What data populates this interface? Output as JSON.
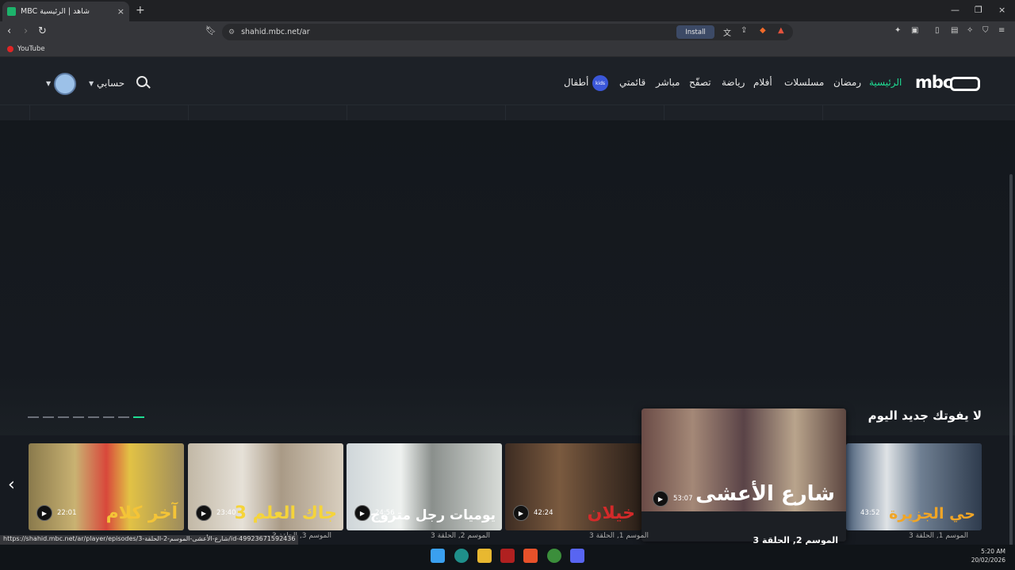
{
  "browser": {
    "tab_title": "MBC شاهد | الرئيسية",
    "tab_close": "×",
    "new_tab": "+",
    "url": "shahid.mbc.net/ar",
    "install_label": "Install",
    "bookmark_youtube": "YouTube",
    "window_minimize": "—",
    "window_restore": "❐",
    "window_close": "×"
  },
  "site": {
    "logo": "mbc",
    "nav": [
      "الرئيسية",
      "رمضان",
      "مسلسلات",
      "أفلام",
      "رياضة",
      "تصفّح",
      "مباشر",
      "قائمتي",
      "أطفال"
    ],
    "kids_badge": "kids",
    "account": "حسابي"
  },
  "content": {
    "section_title": "لا يفوتك جديد اليوم",
    "cards": [
      {
        "logo": "آخر كلام",
        "duration": "22:01",
        "caption": ""
      },
      {
        "logo": "جاك العلم 3",
        "duration": "23:40",
        "caption": "الموسم 3, الحلقة 3"
      },
      {
        "logo": "يوميات رجل متزوج",
        "duration": "24:56",
        "caption": "الموسم 2, الحلقة 3"
      },
      {
        "logo": "خيلان",
        "duration": "42:24",
        "caption": "الموسم 1, الحلقة 3"
      },
      {
        "logo": "حي الجزيرة",
        "duration": "43:52",
        "caption": "الموسم 1, الحلقة 3"
      }
    ],
    "featured": {
      "logo": "شارع الأعشى",
      "duration": "53:07",
      "caption": "الموسم 2, الحلقة 3"
    }
  },
  "status_url": "https://shahid.mbc.net/ar/player/episodes/3-شارع-الأعشى-الموسم-2-الحلقة/id-49923671592436",
  "system": {
    "time": "5:20 AM",
    "date": "20/02/2026"
  },
  "colors": {
    "accent": "#1fdc93",
    "background": "#161a20"
  }
}
